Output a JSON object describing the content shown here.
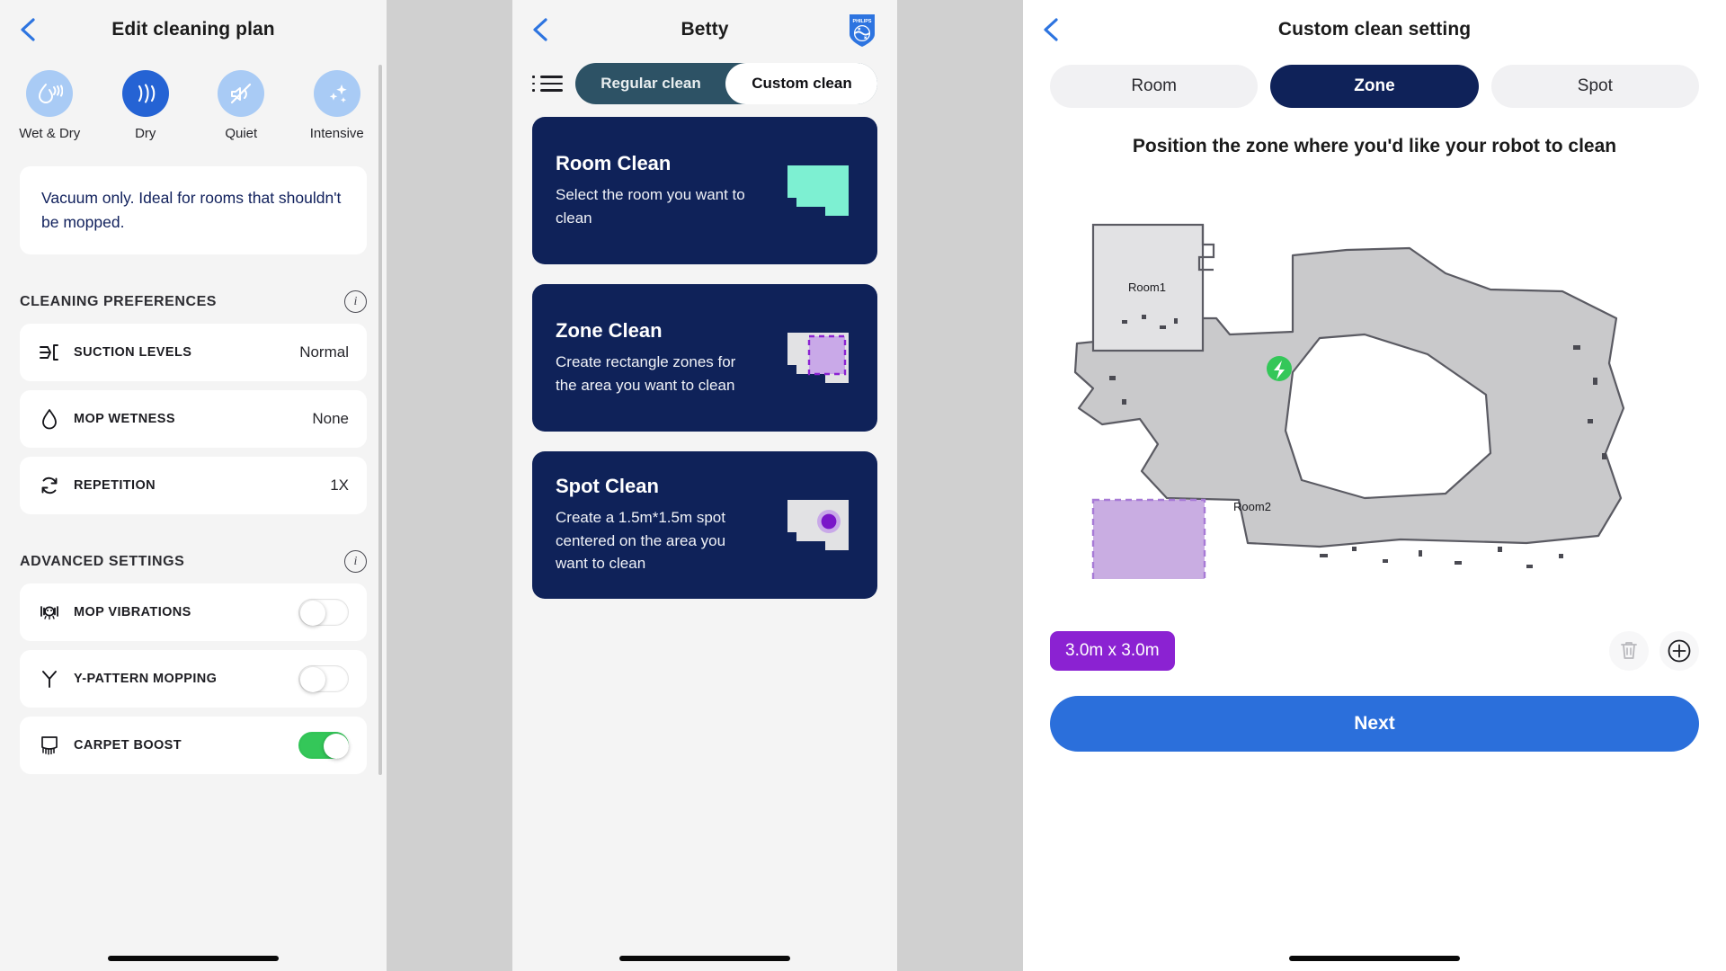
{
  "left_panel": {
    "header": {
      "title": "Edit cleaning plan",
      "back_icon": "chevron-left-icon"
    },
    "modes": [
      {
        "label": "Wet & Dry",
        "icon": "wet-and-dry-icon",
        "active": false
      },
      {
        "label": "Dry",
        "icon": "dry-waves-icon",
        "active": true
      },
      {
        "label": "Quiet",
        "icon": "quiet-muted-icon",
        "active": false
      },
      {
        "label": "Intensive",
        "icon": "intensive-sparkle-icon",
        "active": false
      }
    ],
    "info_text": "Vacuum only. Ideal for rooms that shouldn't be mopped.",
    "cleaning_preferences": {
      "section_title": "CLEANING PREFERENCES",
      "info_icon": "info-circle-icon",
      "rows": [
        {
          "label": "SUCTION LEVELS",
          "value": "Normal",
          "icon": "suction-levels-icon"
        },
        {
          "label": "MOP WETNESS",
          "value": "None",
          "icon": "water-drop-icon"
        },
        {
          "label": "REPETITION",
          "value": "1X",
          "icon": "repeat-arrows-icon"
        }
      ]
    },
    "advanced_settings": {
      "section_title": "ADVANCED SETTINGS",
      "info_icon": "info-circle-icon",
      "rows": [
        {
          "label": "MOP VIBRATIONS",
          "icon": "mop-vibrations-icon",
          "on": false
        },
        {
          "label": "Y-PATTERN MOPPING",
          "icon": "y-pattern-icon",
          "on": false
        },
        {
          "label": "CARPET BOOST",
          "icon": "carpet-boost-icon",
          "on": true
        }
      ]
    }
  },
  "mid_panel": {
    "header": {
      "title": "Betty",
      "back_icon": "chevron-left-icon",
      "brand_icon": "philips-logo-icon",
      "brand_text": "PHILIPS"
    },
    "list_icon": "list-menu-icon",
    "tabs": [
      {
        "label": "Regular clean",
        "active": false
      },
      {
        "label": "Custom clean",
        "active": true
      }
    ],
    "cards": [
      {
        "title": "Room Clean",
        "desc": "Select the room you want to clean",
        "icon": "room-map-icon"
      },
      {
        "title": "Zone Clean",
        "desc": "Create  rectangle zones for the area you want to clean",
        "icon": "zone-map-icon"
      },
      {
        "title": "Spot Clean",
        "desc": "Create a 1.5m*1.5m spot centered on the area you want to clean",
        "icon": "spot-map-icon"
      }
    ]
  },
  "right_panel": {
    "header": {
      "title": "Custom clean setting",
      "back_icon": "chevron-left-icon"
    },
    "segments": [
      {
        "label": "Room",
        "active": false
      },
      {
        "label": "Zone",
        "active": true
      },
      {
        "label": "Spot",
        "active": false
      }
    ],
    "instruction": "Position the zone where you'd like your robot to clean",
    "map": {
      "room_labels": [
        "Room1",
        "Room2"
      ],
      "dock_icon": "charging-dock-icon",
      "resize_handle_icon": "resize-arrows-icon"
    },
    "zone_size_badge": "3.0m x 3.0m",
    "delete_icon": "trash-icon",
    "add_icon": "plus-circle-icon",
    "next_button": "Next"
  },
  "colors": {
    "brand_blue": "#2563d4",
    "card_navy": "#0f2259",
    "accent_purple": "#8b22d2",
    "toggle_on_green": "#34c759",
    "next_blue": "#2b6fdb",
    "mode_inactive": "#a9cbf5",
    "segment_teal": "#2d5265"
  }
}
